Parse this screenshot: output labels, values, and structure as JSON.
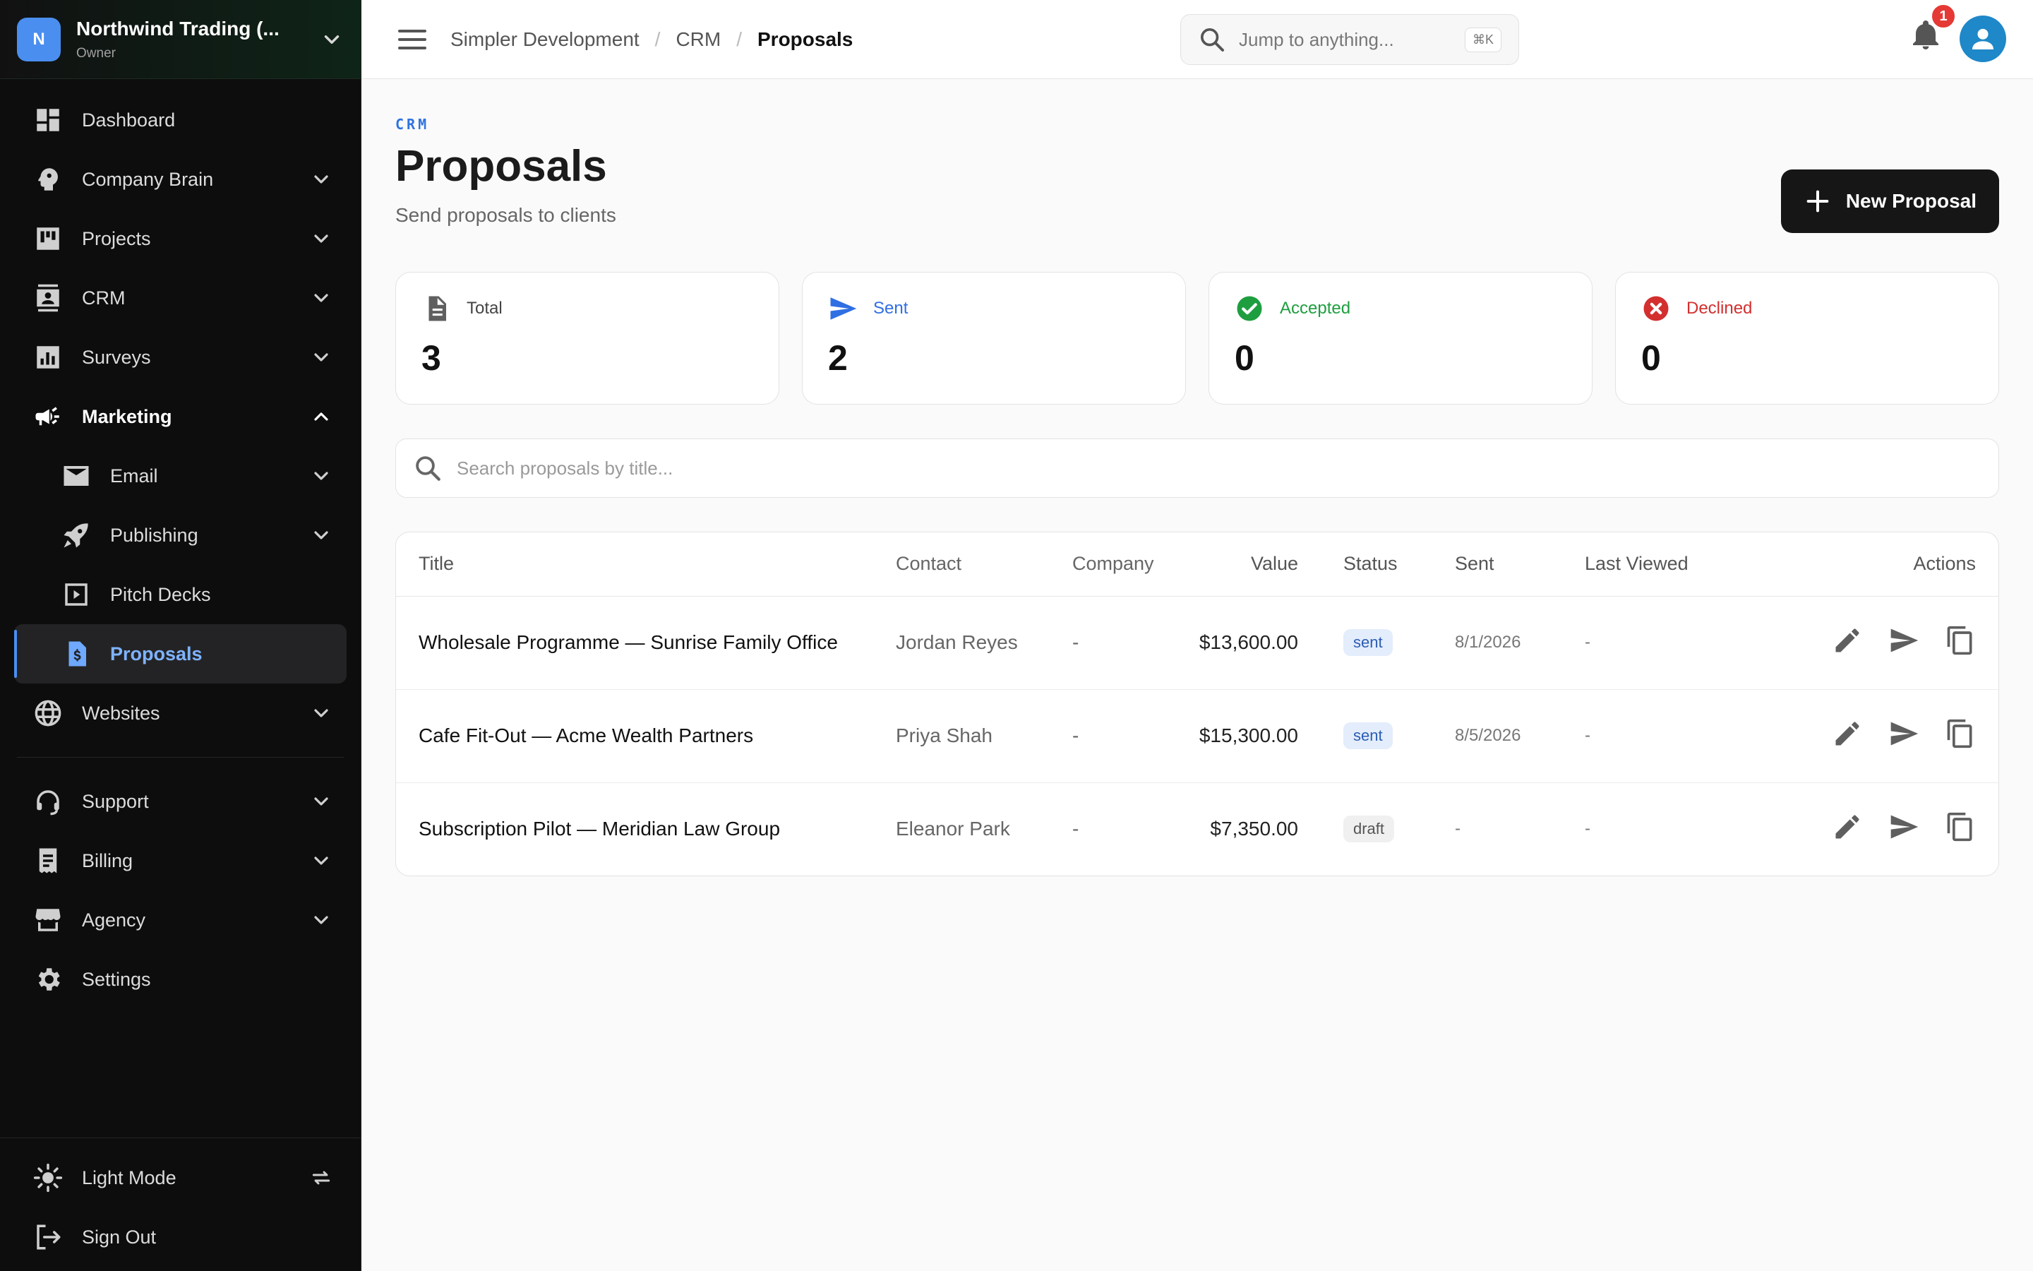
{
  "org": {
    "initial": "N",
    "name": "Northwind Trading (...",
    "role": "Owner"
  },
  "sidebar": {
    "items": [
      {
        "label": "Dashboard",
        "icon": "dashboard-icon"
      },
      {
        "label": "Company Brain",
        "icon": "brain-icon"
      },
      {
        "label": "Projects",
        "icon": "projects-icon"
      },
      {
        "label": "CRM",
        "icon": "contacts-icon"
      },
      {
        "label": "Surveys",
        "icon": "chart-icon"
      },
      {
        "label": "Marketing",
        "icon": "megaphone-icon"
      },
      {
        "label": "Email",
        "icon": "mail-icon"
      },
      {
        "label": "Publishing",
        "icon": "rocket-icon"
      },
      {
        "label": "Pitch Decks",
        "icon": "slideshow-icon"
      },
      {
        "label": "Proposals",
        "icon": "invoice-icon"
      },
      {
        "label": "Websites",
        "icon": "globe-icon"
      }
    ],
    "secondary": [
      {
        "label": "Support",
        "icon": "headset-icon"
      },
      {
        "label": "Billing",
        "icon": "receipt-icon"
      },
      {
        "label": "Agency",
        "icon": "storefront-icon"
      },
      {
        "label": "Settings",
        "icon": "gear-icon"
      }
    ],
    "bottom": [
      {
        "label": "Light Mode",
        "icon": "sun-icon"
      },
      {
        "label": "Sign Out",
        "icon": "logout-icon"
      }
    ]
  },
  "topbar": {
    "breadcrumb": [
      "Simpler Development",
      "CRM",
      "Proposals"
    ],
    "search_placeholder": "Jump to anything...",
    "shortcut": "⌘K",
    "notification_count": "1"
  },
  "page": {
    "eyebrow": "CRM",
    "title": "Proposals",
    "subtitle": "Send proposals to clients",
    "new_button": "New Proposal"
  },
  "stats": [
    {
      "label": "Total",
      "value": "3",
      "color": "#444444"
    },
    {
      "label": "Sent",
      "value": "2",
      "color": "#2f6fe4"
    },
    {
      "label": "Accepted",
      "value": "0",
      "color": "#1e9e3f"
    },
    {
      "label": "Declined",
      "value": "0",
      "color": "#d32f2f"
    }
  ],
  "search": {
    "placeholder": "Search proposals by title..."
  },
  "table": {
    "headers": [
      "Title",
      "Contact",
      "Company",
      "Value",
      "Status",
      "Sent",
      "Last Viewed",
      "Actions"
    ],
    "rows": [
      {
        "title": "Wholesale Programme — Sunrise Family Office",
        "contact": "Jordan Reyes",
        "company": "-",
        "value": "$13,600.00",
        "status": "sent",
        "sent": "8/1/2026",
        "viewed": "-"
      },
      {
        "title": "Cafe Fit-Out — Acme Wealth Partners",
        "contact": "Priya Shah",
        "company": "-",
        "value": "$15,300.00",
        "status": "sent",
        "sent": "8/5/2026",
        "viewed": "-"
      },
      {
        "title": "Subscription Pilot — Meridian Law Group",
        "contact": "Eleanor Park",
        "company": "-",
        "value": "$7,350.00",
        "status": "draft",
        "sent": "-",
        "viewed": "-"
      }
    ]
  },
  "colors": {
    "accent": "#2f73e0",
    "sidebar_bg": "#0d0d0d",
    "active_nav_text": "#7fb3ff"
  }
}
